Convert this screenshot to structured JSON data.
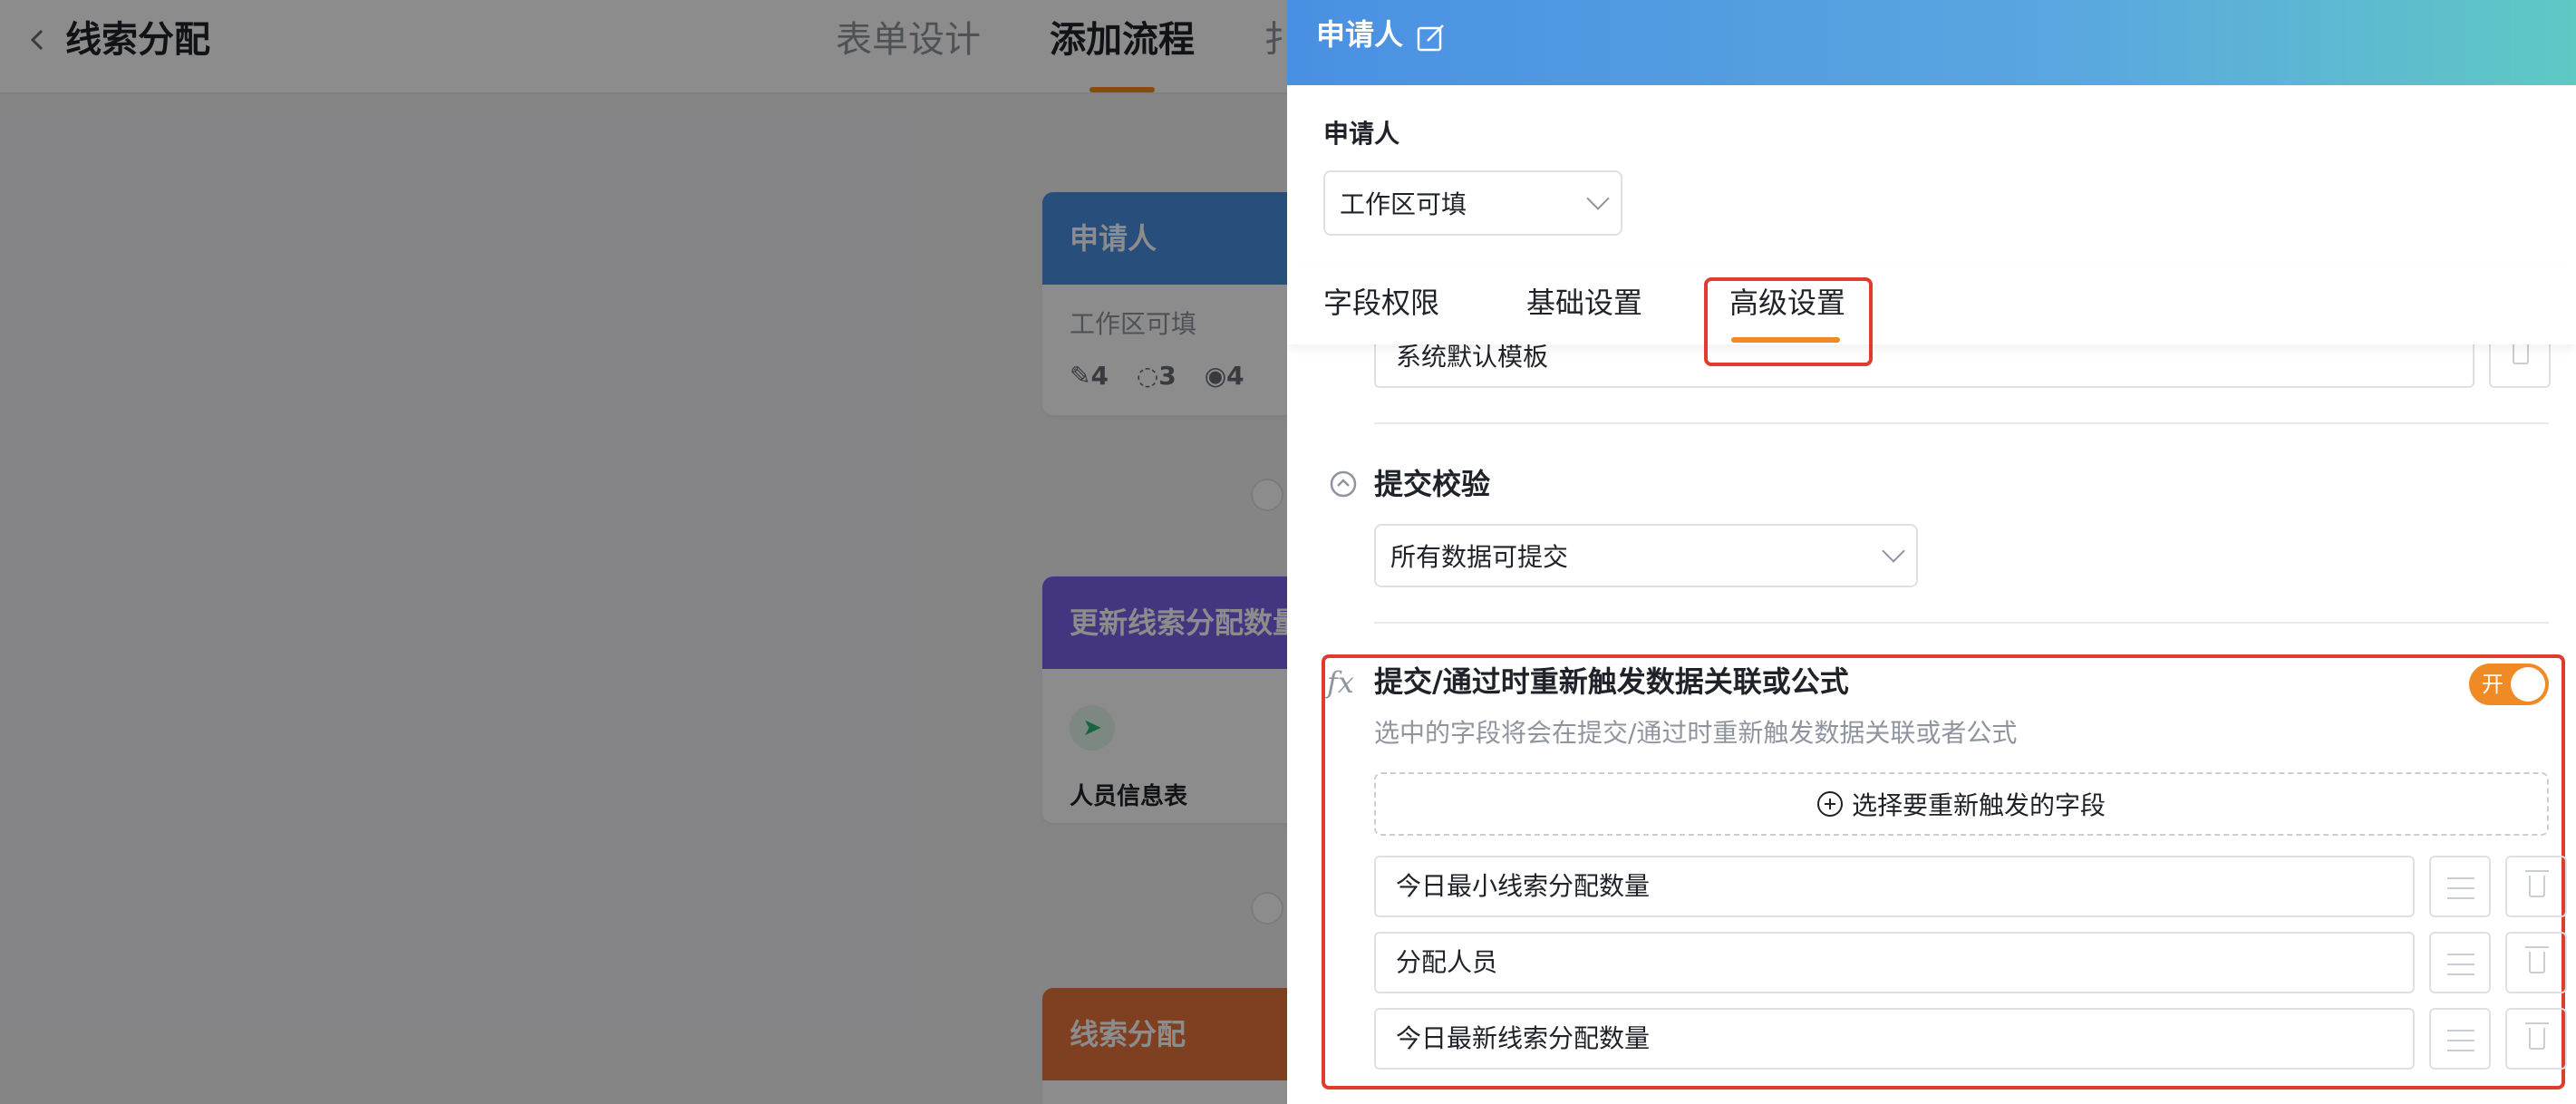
{
  "page": {
    "title": "线索分配",
    "tabs": [
      "表单设计",
      "添加流程",
      "扌"
    ]
  },
  "flow": {
    "card1": {
      "title": "申请人",
      "subtitle": "工作区可填",
      "stats": [
        "4",
        "3",
        "4"
      ]
    },
    "card2": {
      "title": "更新线索分配数量",
      "table": "人员信息表"
    },
    "card3": {
      "title": "线索分配"
    }
  },
  "panel": {
    "title": "申请人",
    "role_label": "申请人",
    "role_select": "工作区可填",
    "tabs": [
      "字段权限",
      "基础设置",
      "高级设置"
    ],
    "active_tab": "高级设置",
    "template_value": "系统默认模板",
    "validation": {
      "title": "提交校验",
      "select": "所有数据可提交"
    },
    "trigger": {
      "title": "提交/通过时重新触发数据关联或公式",
      "toggle_label": "开",
      "toggle_on": true,
      "description": "选中的字段将会在提交/通过时重新触发数据关联或者公式",
      "add_button": "选择要重新触发的字段",
      "fields": [
        "今日最小线索分配数量",
        "分配人员",
        "今日最新线索分配数量"
      ]
    }
  },
  "colors": {
    "accent": "#f08a24",
    "highlight": "#e03c2d",
    "header_start": "#4a90e2",
    "header_end": "#5fc9c4"
  }
}
